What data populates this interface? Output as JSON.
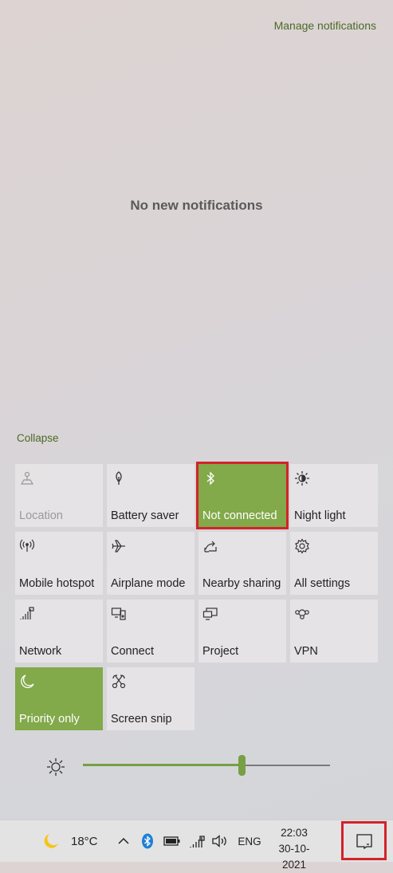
{
  "header": {
    "manage_label": "Manage notifications"
  },
  "notifications": {
    "empty_text": "No new notifications"
  },
  "quick_actions": {
    "collapse_label": "Collapse",
    "tiles": [
      {
        "label": "Location",
        "icon": "location-icon",
        "state": "disabled"
      },
      {
        "label": "Battery saver",
        "icon": "battery-saver-icon",
        "state": "off"
      },
      {
        "label": "Not connected",
        "icon": "bluetooth-icon",
        "state": "on"
      },
      {
        "label": "Night light",
        "icon": "night-light-icon",
        "state": "off"
      },
      {
        "label": "Mobile hotspot",
        "icon": "mobile-hotspot-icon",
        "state": "off"
      },
      {
        "label": "Airplane mode",
        "icon": "airplane-icon",
        "state": "off"
      },
      {
        "label": "Nearby sharing",
        "icon": "nearby-sharing-icon",
        "state": "off"
      },
      {
        "label": "All settings",
        "icon": "gear-icon",
        "state": "off"
      },
      {
        "label": "Network",
        "icon": "network-icon",
        "state": "off"
      },
      {
        "label": "Connect",
        "icon": "connect-icon",
        "state": "off"
      },
      {
        "label": "Project",
        "icon": "project-icon",
        "state": "off"
      },
      {
        "label": "VPN",
        "icon": "vpn-icon",
        "state": "off"
      },
      {
        "label": "Priority only",
        "icon": "moon-icon",
        "state": "on"
      },
      {
        "label": "Screen snip",
        "icon": "screen-snip-icon",
        "state": "off"
      }
    ]
  },
  "brightness": {
    "level": 0.645
  },
  "taskbar": {
    "temperature": "18°C",
    "language": "ENG",
    "time": "22:03",
    "date": "30-10-2021"
  },
  "colors": {
    "accent": "#82a94a",
    "highlight": "#d2232a",
    "link": "#4a6a28"
  }
}
